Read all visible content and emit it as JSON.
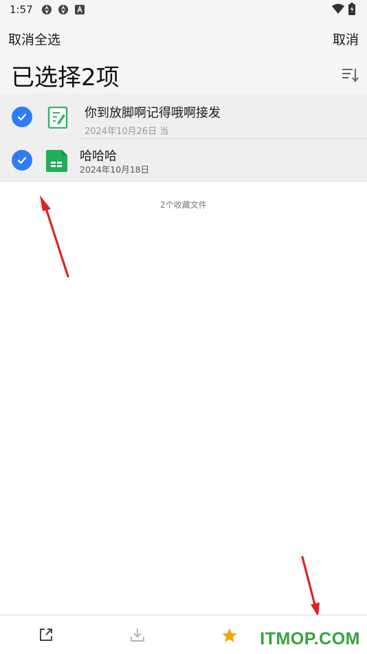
{
  "status_bar": {
    "time": "1:57",
    "icons": [
      "sync-icon",
      "sync-icon",
      "a-badge-icon",
      "wifi-icon",
      "battery-icon"
    ]
  },
  "toolbar": {
    "cancel_select_all": "取消全选",
    "cancel": "取消",
    "title": "已选择2项"
  },
  "files": [
    {
      "name": "你到放脚啊记得哦啊接发",
      "meta": "2024年10月26日 当",
      "icon": "note-doc-icon",
      "selected": true
    },
    {
      "name": "哈哈哈",
      "meta": "2024年10月18日",
      "icon": "spreadsheet-icon",
      "selected": true
    }
  ],
  "summary": {
    "count_text": "2个收藏文件"
  },
  "bottom_bar": {
    "actions": [
      "share-icon",
      "download-icon",
      "star-icon"
    ],
    "watermark": "ITMOP.COM"
  },
  "colors": {
    "accent": "#2f7cf6",
    "star": "#f5a300",
    "note_icon": "#2eb45f",
    "sheet_icon": "#1faf5b",
    "watermark": "#39a13d",
    "arrow": "#dd2222"
  }
}
